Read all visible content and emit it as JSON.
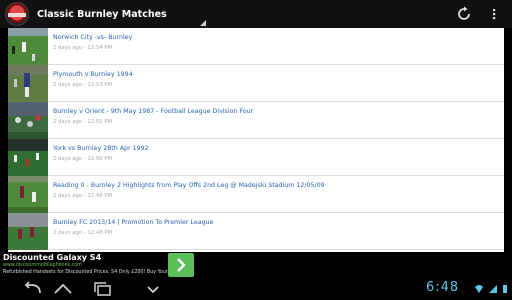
{
  "app": {
    "title": "Classic Burnley Matches"
  },
  "icons": {
    "logo": "burnley-crest-icon",
    "refresh": "refresh-icon",
    "overflow": "overflow-menu-icon"
  },
  "videos": [
    {
      "title": "Norwich City -vs- Burnley",
      "time": "2 days ago - 12:54 PM"
    },
    {
      "title": "Plymouth v Burnley 1994",
      "time": "2 days ago - 12:53 PM"
    },
    {
      "title": "Burnley v Orient - 9th May 1987 - Football League Division Four",
      "time": "2 days ago - 12:51 PM"
    },
    {
      "title": "York vs Burnley 28th Apr 1992",
      "time": "2 days ago - 12:50 PM"
    },
    {
      "title": "Reading 0 - Burnley 2 Highlights from Play Offs 2nd Leg @ Madejski Stadium 12/05/09",
      "time": "2 days ago - 12:48 PM"
    },
    {
      "title": "Burnley FC 2013/14 | Promotion To Premier League",
      "time": "2 days ago - 12:48 PM"
    }
  ],
  "ad": {
    "title": "Discounted Galaxy S4",
    "url": "www.discountmobilephones.com",
    "text": "Refurbished Handsets for Discounted Prices. S4 Only £200! Buy Yours Now"
  },
  "status": {
    "time": "6:48"
  },
  "colors": {
    "link": "#2a62b6",
    "clock": "#5ac8e8",
    "ad_button": "#5cbf5c"
  }
}
